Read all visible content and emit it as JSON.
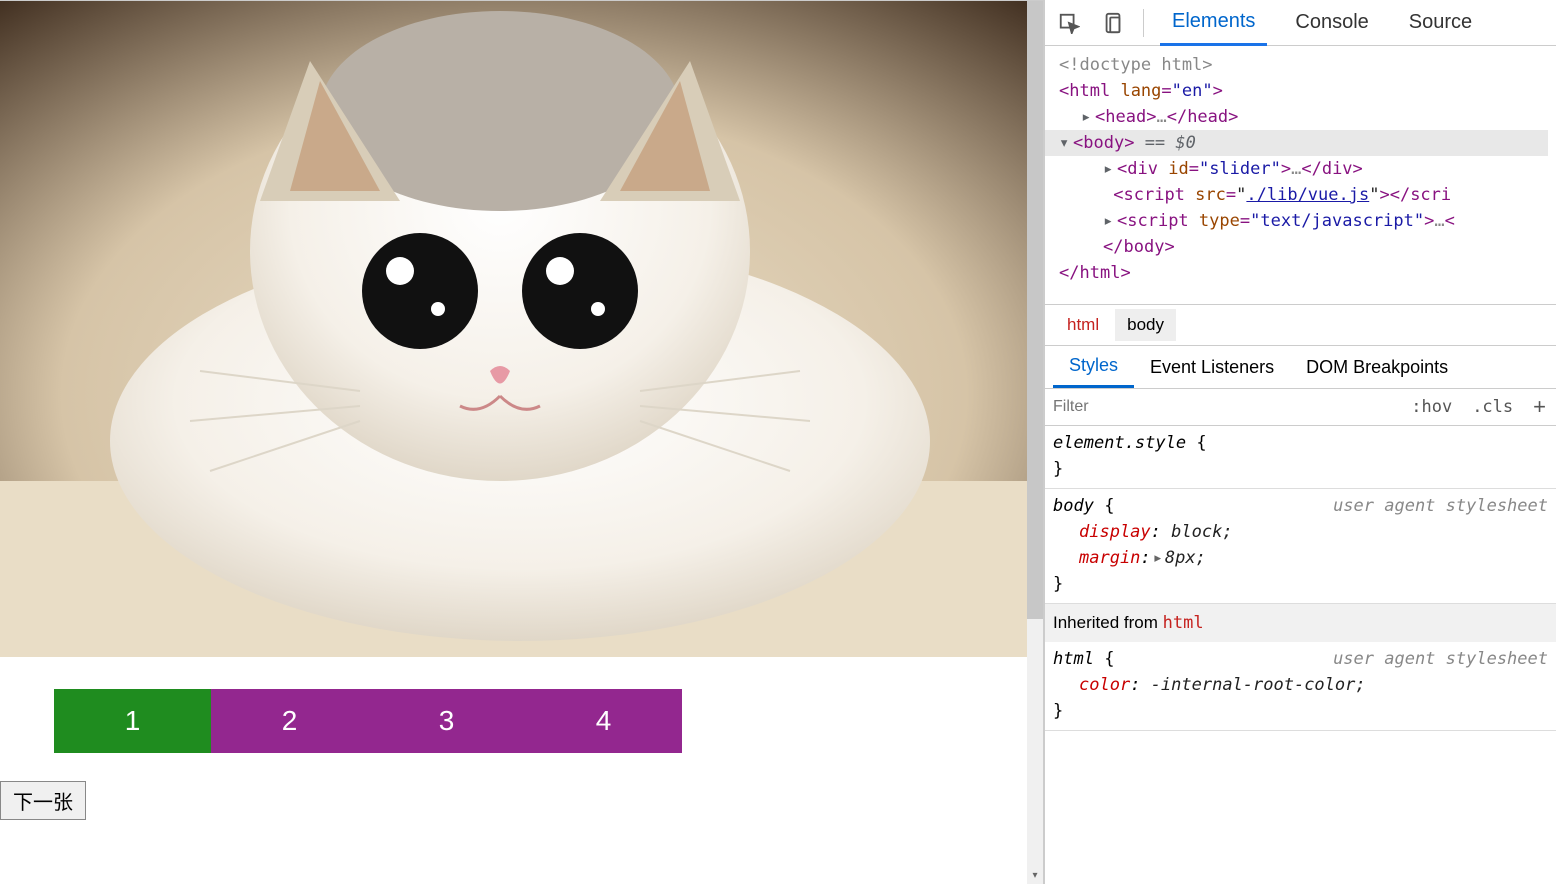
{
  "page": {
    "pager": [
      "1",
      "2",
      "3",
      "4"
    ],
    "active_index": 0,
    "next_button_label": "下一张"
  },
  "devtools": {
    "tabs": [
      "Elements",
      "Console",
      "Source"
    ],
    "active_tab": "Elements",
    "dom": {
      "doctype": "<!doctype html>",
      "html_open": {
        "tag": "html",
        "attr_name": "lang",
        "attr_val": "\"en\""
      },
      "head": {
        "open": "head",
        "ellipsis": "…",
        "close": "/head"
      },
      "body_open": {
        "tag": "body",
        "suffix": " == $0"
      },
      "div": {
        "tag": "div",
        "attr_name": "id",
        "attr_val": "\"slider\"",
        "ellipsis": "…",
        "close": "/div"
      },
      "script1": {
        "tag": "script",
        "attr_name": "src",
        "attr_val": "./lib/vue.js",
        "close": "/scri"
      },
      "script2": {
        "tag": "script",
        "attr_name": "type",
        "attr_val": "\"text/javascript\"",
        "ellipsis": "…"
      },
      "body_close": "/body",
      "html_close": "/html"
    },
    "crumbs": [
      "html",
      "body"
    ],
    "styles_tabs": [
      "Styles",
      "Event Listeners",
      "DOM Breakpoints"
    ],
    "active_styles_tab": "Styles",
    "filter_placeholder": "Filter",
    "filter_hov": ":hov",
    "filter_cls": ".cls",
    "rules": {
      "element_style": {
        "selector": "element.style",
        "open": "{",
        "close": "}"
      },
      "body": {
        "selector": "body",
        "origin": "user agent stylesheet",
        "props": [
          {
            "name": "display",
            "value": "block;"
          },
          {
            "name": "margin",
            "arrow": "▸",
            "value": "8px;"
          }
        ]
      },
      "inherit_label": "Inherited from",
      "inherit_from": "html",
      "html": {
        "selector": "html",
        "origin": "user agent stylesheet",
        "props": [
          {
            "name": "color",
            "value": "-internal-root-color;"
          }
        ]
      }
    }
  }
}
